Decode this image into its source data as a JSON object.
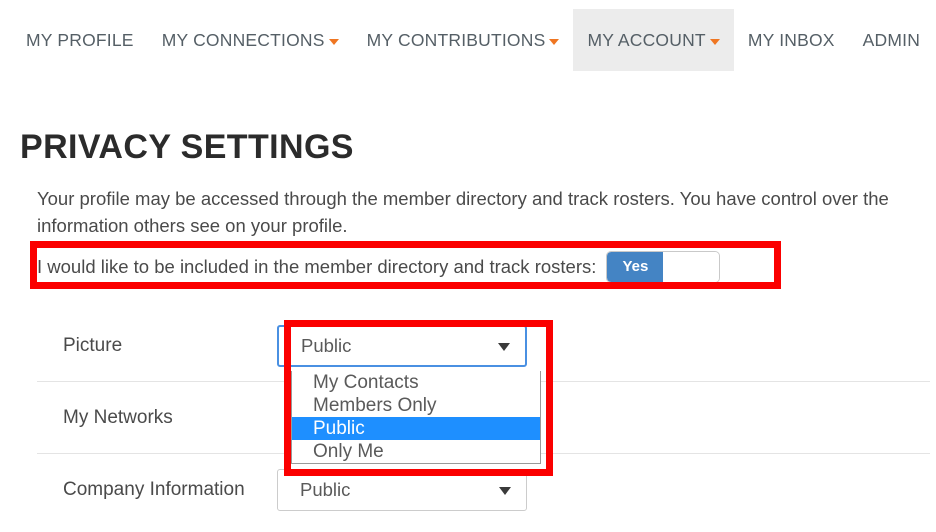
{
  "nav": {
    "items": [
      {
        "label": "MY PROFILE",
        "has_caret": false,
        "active": false
      },
      {
        "label": "MY CONNECTIONS",
        "has_caret": true,
        "active": false
      },
      {
        "label": "MY CONTRIBUTIONS",
        "has_caret": true,
        "active": false
      },
      {
        "label": "MY ACCOUNT",
        "has_caret": true,
        "active": true
      },
      {
        "label": "MY INBOX",
        "has_caret": false,
        "active": false
      },
      {
        "label": "ADMIN",
        "has_caret": false,
        "active": false
      }
    ]
  },
  "page": {
    "title": "PRIVACY SETTINGS",
    "intro": "Your profile may be accessed through the member directory and track rosters. You have control over the information others see on your profile."
  },
  "optin": {
    "label": "I would like to be included in the member directory and track rosters:",
    "toggle_value": "Yes"
  },
  "settings": {
    "rows": [
      {
        "name": "Picture",
        "value": "Public"
      },
      {
        "name": "My Networks",
        "value": ""
      },
      {
        "name": "Company Information",
        "value": "Public"
      }
    ]
  },
  "dropdown": {
    "open": true,
    "selected": "Public",
    "options": [
      {
        "label": "My Contacts",
        "selected": false
      },
      {
        "label": "Members Only",
        "selected": false
      },
      {
        "label": "Public",
        "selected": true
      },
      {
        "label": "Only Me",
        "selected": false
      }
    ]
  },
  "colors": {
    "caret_orange": "#ef7622",
    "toggle_blue": "#4484c4",
    "option_highlight_blue": "#1e8fff",
    "annotation_red": "#fb0000",
    "nav_active_gray": "#ececec"
  },
  "annotations": [
    {
      "name": "optin-highlight"
    },
    {
      "name": "picture-dropdown-highlight"
    }
  ]
}
